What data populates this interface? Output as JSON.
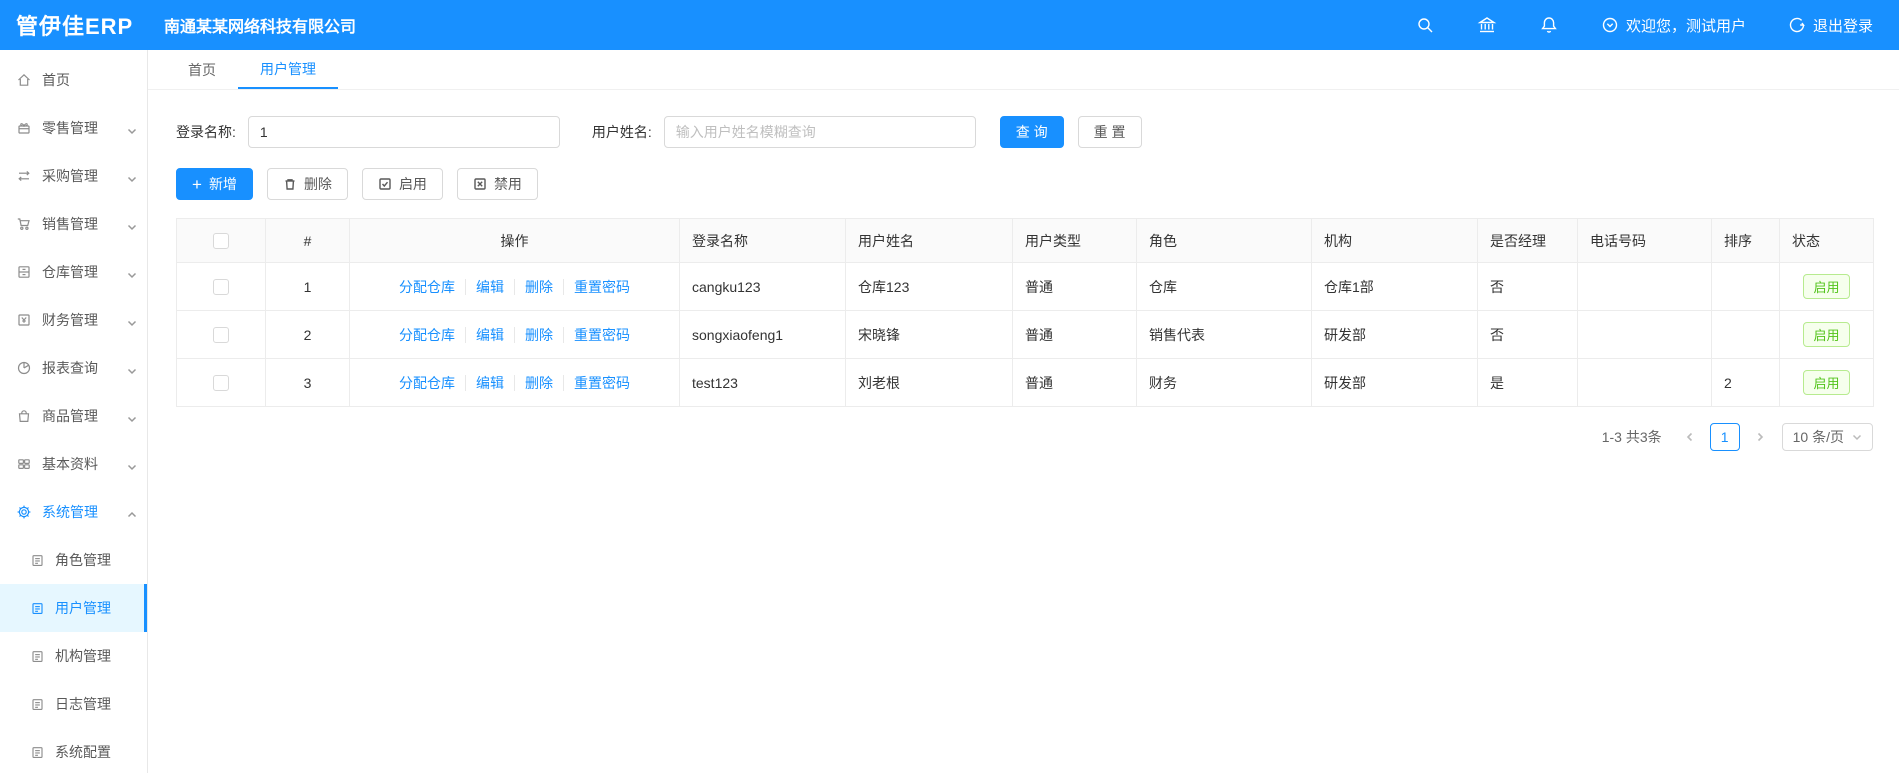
{
  "topbar": {
    "logo": "管伊佳ERP",
    "company": "南通某某网络科技有限公司",
    "icons": [
      "search-icon",
      "bank-icon",
      "bell-icon"
    ],
    "welcome": "欢迎您，测试用户",
    "logout": "退出登录"
  },
  "colors": {
    "accent": "#1890ff",
    "active_bg": "#e6f7ff",
    "status_green": "#52c41a"
  },
  "sidebar": {
    "items": [
      {
        "label": "首页",
        "icon": "home-icon",
        "chevron": ""
      },
      {
        "label": "零售管理",
        "icon": "retail-icon",
        "chevron": "down"
      },
      {
        "label": "采购管理",
        "icon": "purchase-icon",
        "chevron": "down"
      },
      {
        "label": "销售管理",
        "icon": "cart-icon",
        "chevron": "down"
      },
      {
        "label": "仓库管理",
        "icon": "warehouse-icon",
        "chevron": "down"
      },
      {
        "label": "财务管理",
        "icon": "finance-icon",
        "chevron": "down"
      },
      {
        "label": "报表查询",
        "icon": "pie-chart-icon",
        "chevron": "down"
      },
      {
        "label": "商品管理",
        "icon": "goods-icon",
        "chevron": "down"
      },
      {
        "label": "基本资料",
        "icon": "grid-icon",
        "chevron": "down"
      },
      {
        "label": "系统管理",
        "icon": "gear-icon",
        "chevron": "up",
        "active": true
      }
    ],
    "submenu": [
      {
        "label": "角色管理",
        "icon": "doc-icon"
      },
      {
        "label": "用户管理",
        "icon": "doc-icon",
        "active": true
      },
      {
        "label": "机构管理",
        "icon": "doc-icon"
      },
      {
        "label": "日志管理",
        "icon": "doc-icon"
      },
      {
        "label": "系统配置",
        "icon": "doc-icon"
      }
    ]
  },
  "tabs": [
    {
      "label": "首页"
    },
    {
      "label": "用户管理",
      "active": true
    }
  ],
  "filter": {
    "login_label": "登录名称:",
    "login_value": "1",
    "name_label": "用户姓名:",
    "name_placeholder": "输入用户姓名模糊查询",
    "search_btn": "查 询",
    "reset_btn": "重 置"
  },
  "actions": {
    "add": "新增",
    "delete": "删除",
    "enable": "启用",
    "disable": "禁用"
  },
  "table": {
    "columns": [
      "#",
      "操作",
      "登录名称",
      "用户姓名",
      "用户类型",
      "角色",
      "机构",
      "是否经理",
      "电话号码",
      "排序",
      "状态"
    ],
    "ops": [
      "分配仓库",
      "编辑",
      "删除",
      "重置密码"
    ],
    "rows": [
      {
        "index": "1",
        "login": "cangku123",
        "name": "仓库123",
        "type": "普通",
        "role": "仓库",
        "org": "仓库1部",
        "manager": "否",
        "phone": "",
        "sort": "",
        "status": "启用"
      },
      {
        "index": "2",
        "login": "songxiaofeng1",
        "name": "宋晓锋",
        "type": "普通",
        "role": "销售代表",
        "org": "研发部",
        "manager": "否",
        "phone": "",
        "sort": "",
        "status": "启用"
      },
      {
        "index": "3",
        "login": "test123",
        "name": "刘老根",
        "type": "普通",
        "role": "财务",
        "org": "研发部",
        "manager": "是",
        "phone": "",
        "sort": "2",
        "status": "启用"
      }
    ]
  },
  "pagination": {
    "total": "1-3 共3条",
    "page": "1",
    "page_size": "10 条/页"
  }
}
